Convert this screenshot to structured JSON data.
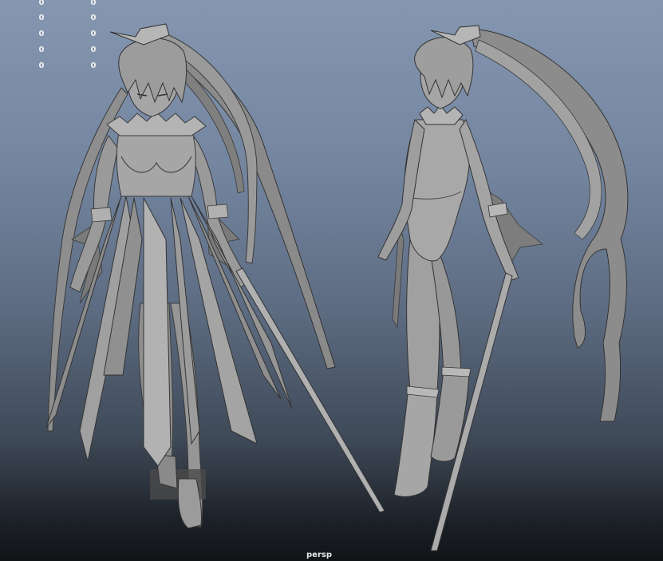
{
  "viewport": {
    "camera_name": "persp",
    "hud": {
      "column_a": [
        "0",
        "0",
        "0",
        "0",
        "0"
      ],
      "column_b": [
        "0",
        "0",
        "0",
        "0",
        "0"
      ]
    }
  },
  "colors": {
    "shade_light": "#a8a8a8",
    "shade_mid": "#8c8c8c",
    "shade_dark": "#5a5a5a",
    "outline": "#303030",
    "hud_text": "#f2f2f2"
  }
}
